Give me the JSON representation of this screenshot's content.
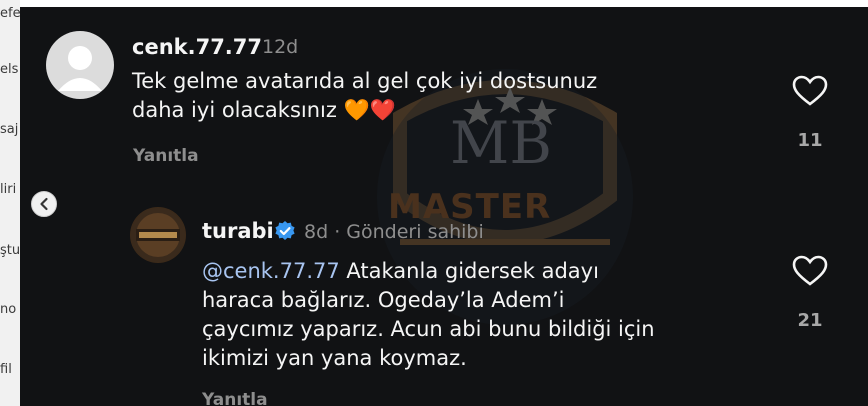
{
  "background_page": {
    "fragments": [
      "efe",
      "els",
      "saj",
      "liri",
      "ştu",
      "no",
      "fil"
    ]
  },
  "comment1": {
    "username": "cenk.77.77",
    "time": "12d",
    "text_line1": "Tek gelme avatarıda al gel çok iyi dostsunuz",
    "text_line2": "daha iyi olacaksınız",
    "emojis": "🧡❤️",
    "reply_label": "Yanıtla",
    "like_count": "11",
    "avatar_icon": "default-user-avatar"
  },
  "comment2": {
    "username": "turabi",
    "verified_icon": "verified-badge-icon",
    "time": "8d",
    "separator": "·",
    "author_label": "Gönderi sahibi",
    "mention": "@cenk.77.77",
    "text_line1_rest": " Atakanla gidersek adayı",
    "text_line2": "haraca bağlarız. Ogeday’la Adem’i",
    "text_line3": "çaycımız yaparız. Acun abi bunu bildiği için",
    "text_line4": "ikimizi yan yana koymaz.",
    "reply_label": "Yanıtla",
    "like_count": "21"
  },
  "watermark": {
    "text": "MASTER",
    "monogram": "MB"
  },
  "colors": {
    "panel_bg": "#111214",
    "text": "#f5f5f5",
    "muted": "#8e8e8e",
    "mention": "#a8c4f0",
    "verified": "#3897f0"
  }
}
